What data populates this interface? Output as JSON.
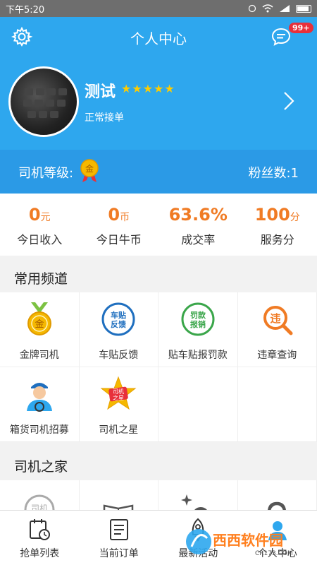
{
  "status_bar": {
    "time": "下午5:20"
  },
  "header": {
    "title": "个人中心",
    "msg_badge": "99+"
  },
  "profile": {
    "name": "测试",
    "stars": "★★★★★",
    "status": "正常接单"
  },
  "level_bar": {
    "level_label": "司机等级:",
    "medal_text": "金",
    "fans": "粉丝数:1"
  },
  "stats": [
    {
      "value": "0",
      "unit": "元",
      "label": "今日收入"
    },
    {
      "value": "0",
      "unit": "币",
      "label": "今日牛币"
    },
    {
      "value": "63.6%",
      "unit": "",
      "label": "成交率"
    },
    {
      "value": "100",
      "unit": "分",
      "label": "服务分"
    }
  ],
  "sections": {
    "common": "常用频道",
    "home": "司机之家"
  },
  "channels": [
    {
      "label": "金牌司机",
      "icon": "gold-medal-icon",
      "icon_text": "金"
    },
    {
      "label": "车贴反馈",
      "icon": "sticker-feedback-icon",
      "icon_text": [
        "车贴",
        "反馈"
      ]
    },
    {
      "label": "贴车贴报罚款",
      "icon": "fine-report-icon",
      "icon_text": [
        "罚款",
        "报销"
      ]
    },
    {
      "label": "违章查询",
      "icon": "violation-query-icon",
      "icon_text": "违"
    },
    {
      "label": "箱货司机招募",
      "icon": "driver-recruit-icon"
    },
    {
      "label": "司机之星",
      "icon": "driver-star-icon",
      "icon_text": [
        "司机",
        "之星"
      ]
    }
  ],
  "home_icons": [
    {
      "icon": "driver-badge-icon",
      "icon_text": "司机"
    },
    {
      "icon": "book-icon"
    },
    {
      "icon": "activity-icon"
    },
    {
      "icon": "support-icon"
    }
  ],
  "tabs": [
    {
      "label": "抢单列表",
      "icon": "order-list-icon"
    },
    {
      "label": "当前订单",
      "icon": "current-order-icon"
    },
    {
      "label": "最新活动",
      "icon": "rocket-icon"
    },
    {
      "label": "个人中心",
      "icon": "profile-icon"
    }
  ],
  "watermark": {
    "text": "西西软件园",
    "sub": "CR173.COM"
  },
  "colors": {
    "primary": "#2ea7ee",
    "accent": "#f07b24",
    "badge": "#e8303a"
  }
}
